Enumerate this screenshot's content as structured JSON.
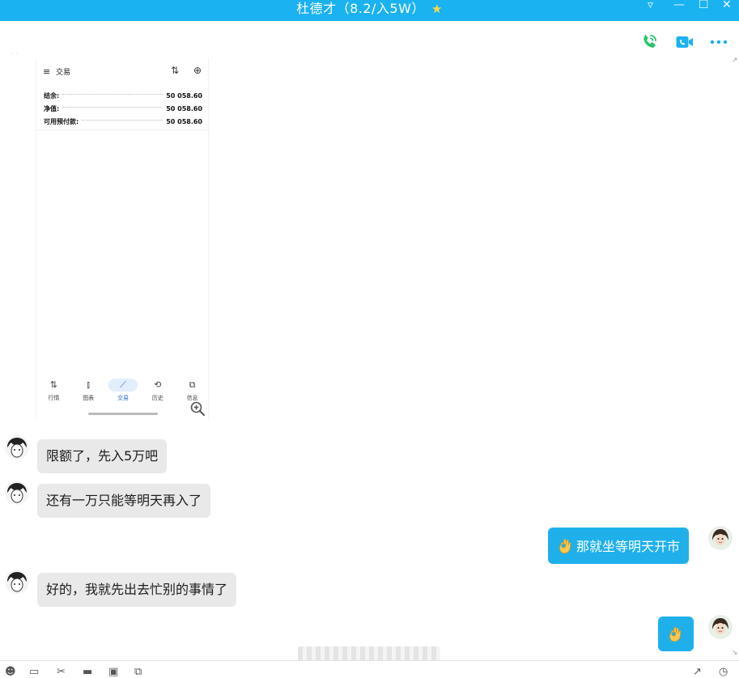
{
  "window": {
    "title": "杜德才（8.2/入5W）",
    "title_star": "★",
    "controls": [
      "▿",
      "—",
      "☐",
      "✕"
    ]
  },
  "toolbar": {
    "icons": [
      "phone-call-icon",
      "video-call-icon",
      "more-icon"
    ],
    "colors": {
      "phone": "#27c66b",
      "video": "#1ab2f0",
      "more": "#1ab2f0"
    }
  },
  "screenshot_image": {
    "header_title": "交易",
    "header_menu_icon": "≡",
    "header_sort_icon": "⇅",
    "header_add_icon": "⊕",
    "rows": [
      {
        "label": "结余:",
        "value": "50 058.60"
      },
      {
        "label": "净值:",
        "value": "50 058.60"
      },
      {
        "label": "可用预付款:",
        "value": "50 058.60"
      }
    ],
    "nav": [
      {
        "icon": "⇅",
        "label": "行情",
        "active": false
      },
      {
        "icon": "⫾",
        "label": "图表",
        "active": false
      },
      {
        "icon": "⟋",
        "label": "交易",
        "active": true
      },
      {
        "icon": "⟲",
        "label": "历史",
        "active": false
      },
      {
        "icon": "⧉",
        "label": "信息",
        "active": false
      }
    ]
  },
  "messages": [
    {
      "from": "them",
      "text": "限额了，先入5万吧"
    },
    {
      "from": "them",
      "text": "还有一万只能等明天再入了"
    },
    {
      "from": "me",
      "emoji": "ok-hand",
      "text": "那就坐等明天开市"
    },
    {
      "from": "them",
      "text": "好的，我就先出去忙别的事情了"
    },
    {
      "from": "me",
      "emoji": "ok-hand",
      "text": ""
    }
  ]
}
